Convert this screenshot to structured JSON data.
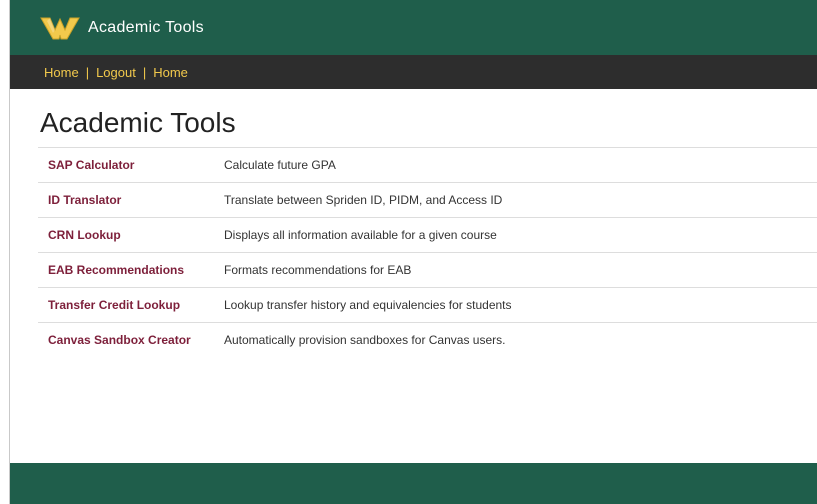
{
  "header": {
    "app_title": "Academic Tools",
    "logo_icon": "wsu-w-logo-icon",
    "colors": {
      "brand_green": "#1f5e4b",
      "brand_gold": "#f2c94c",
      "nav_bg": "#2d2d2d",
      "link_maroon": "#7d1f3a"
    }
  },
  "nav": {
    "items": [
      {
        "label": "Home"
      },
      {
        "label": "Logout"
      },
      {
        "label": "Home"
      }
    ],
    "separator": "|"
  },
  "main": {
    "page_title": "Academic Tools",
    "tools": [
      {
        "name": "SAP Calculator",
        "description": "Calculate future GPA"
      },
      {
        "name": "ID Translator",
        "description": "Translate between Spriden ID, PIDM, and Access ID"
      },
      {
        "name": "CRN Lookup",
        "description": "Displays all information available for a given course"
      },
      {
        "name": "EAB Recommendations",
        "description": "Formats recommendations for EAB"
      },
      {
        "name": "Transfer Credit Lookup",
        "description": "Lookup transfer history and equivalencies for students"
      },
      {
        "name": "Canvas Sandbox Creator",
        "description": "Automatically provision sandboxes for Canvas users."
      }
    ]
  }
}
